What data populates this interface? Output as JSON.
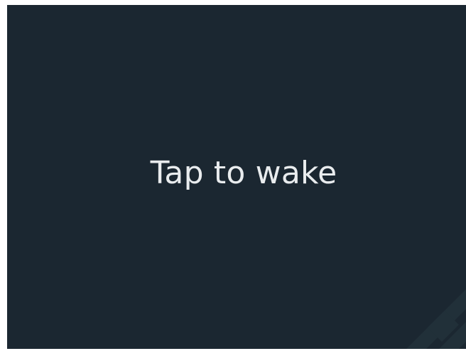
{
  "screen": {
    "prompt_text": "Tap to wake",
    "background_color": "#1b2731",
    "text_color": "#e9ecee"
  },
  "decoration": {
    "corner_icon": "watermark-pattern-icon"
  }
}
